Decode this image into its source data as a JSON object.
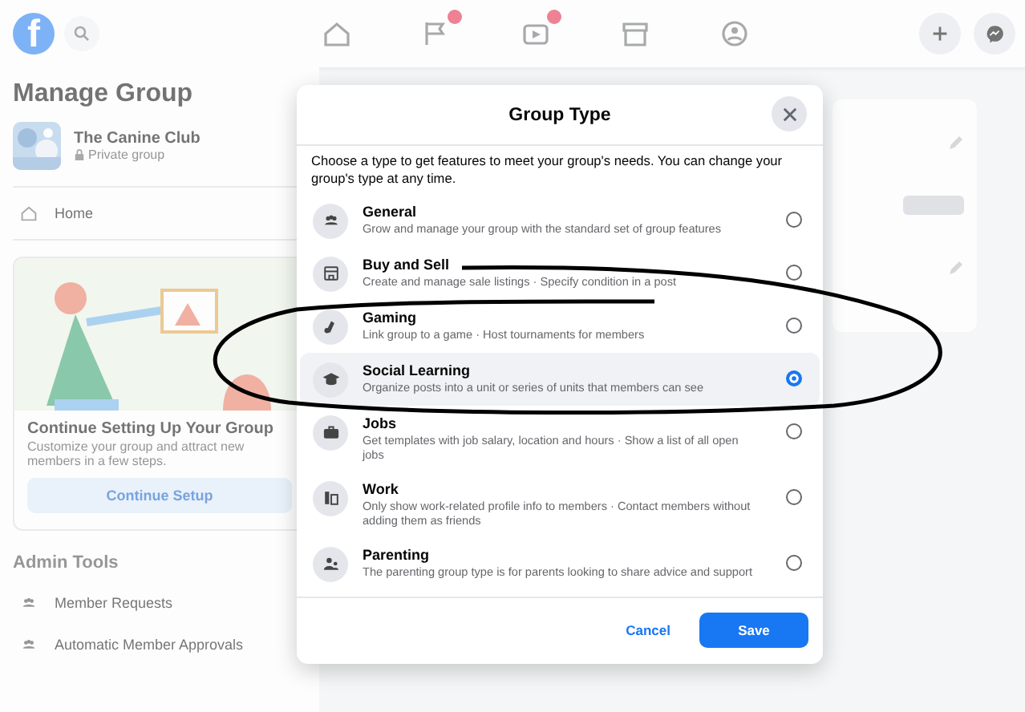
{
  "topbar": {
    "logo": "f",
    "nav": [
      {
        "kind": "home",
        "badge": false
      },
      {
        "kind": "flag",
        "badge": true
      },
      {
        "kind": "video",
        "badge": true
      },
      {
        "kind": "store",
        "badge": false
      },
      {
        "kind": "groups",
        "badge": false
      }
    ],
    "actions": [
      {
        "kind": "plus"
      },
      {
        "kind": "messenger"
      }
    ]
  },
  "sidebar": {
    "title": "Manage Group",
    "group": {
      "name": "The Canine Club",
      "privacy": "Private group"
    },
    "home": "Home",
    "setup_card": {
      "heading": "Continue Setting Up Your Group",
      "text": "Customize your group and attract new members in a few steps.",
      "button": "Continue Setup"
    },
    "admin_title": "Admin Tools",
    "admin_items": [
      {
        "label": "Member Requests"
      },
      {
        "label": "Automatic Member Approvals"
      }
    ]
  },
  "dialog": {
    "title": "Group Type",
    "intro": "Choose a type to get features to meet your group's needs. You can change your group's type at any time.",
    "types": [
      {
        "kind": "general",
        "title": "General",
        "description": "Grow and manage your group with the standard set of group features",
        "selected": false
      },
      {
        "kind": "buy",
        "title": "Buy and Sell",
        "description": "Create and manage sale listings · Specify condition in a post",
        "selected": false
      },
      {
        "kind": "gaming",
        "title": "Gaming",
        "description": "Link group to a game · Host tournaments for members",
        "selected": false
      },
      {
        "kind": "learning",
        "title": "Social Learning",
        "description": "Organize posts into a unit or series of units that members can see",
        "selected": true
      },
      {
        "kind": "jobs",
        "title": "Jobs",
        "description": "Get templates with job salary, location and hours · Show a list of all open jobs",
        "selected": false
      },
      {
        "kind": "work",
        "title": "Work",
        "description": "Only show work-related profile info to members · Contact members without adding them as friends",
        "selected": false
      },
      {
        "kind": "parenting",
        "title": "Parenting",
        "description": "The parenting group type is for parents looking to share advice and support",
        "selected": false
      }
    ],
    "cancel": "Cancel",
    "save": "Save"
  },
  "annotations": [
    {
      "kind": "ellipse"
    }
  ]
}
